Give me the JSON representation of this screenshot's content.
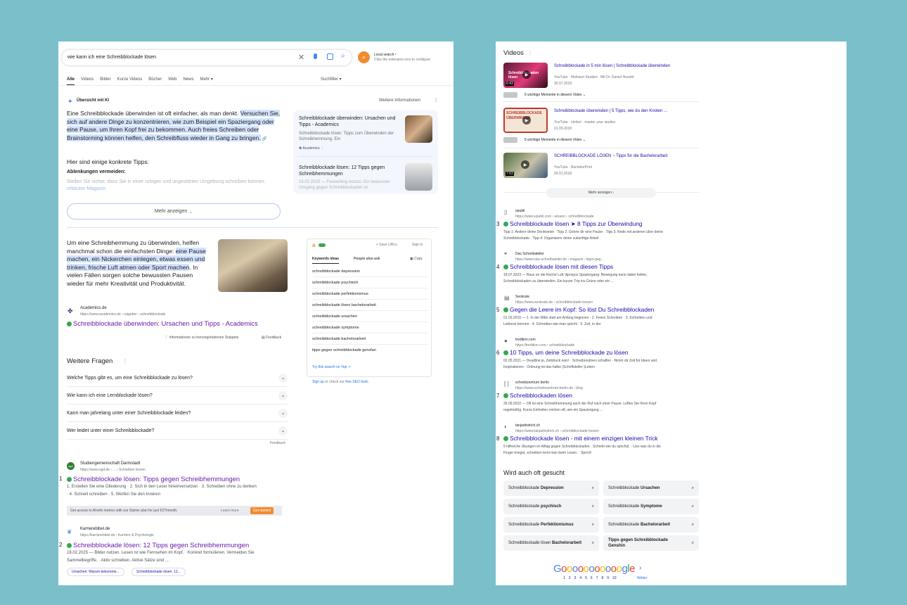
{
  "search": {
    "query": "wie kann ich eine Schreibblockade lösen",
    "ext_title": "Local search ¹",
    "ext_sub": "Click the extension icon to configure",
    "tabs": [
      "Alle",
      "Videos",
      "Bilder",
      "Kurze Videos",
      "Bücher",
      "Web",
      "News",
      "Mehr ▾"
    ],
    "tools": "Suchfilter ▾"
  },
  "ai": {
    "title": "Übersicht mit KI",
    "more_info": "Weitere Informationen",
    "p1_plain": "Eine Schreibblockade überwinden ist oft einfacher, als man denkt. ",
    "p1_hl": "Versuchen Sie, sich auf andere Dinge zu konzentrieren, wie zum Beispiel ein Spaziergang oder eine Pause, um Ihren Kopf frei zu bekommen.  Auch freies Schreiben oder Brainstorming können helfen, den Schreibfluss wieder in Gang zu bringen.",
    "tips_heading": "Hier sind einige konkrete Tipps:",
    "sub_heading": "Ablenkungen vermeiden:",
    "fade_text": "Stellen Sie sicher, dass Sie in einer ruhigen und ungestörten Umgebung schreiben können.",
    "fade_source": "refatutor-Magazin",
    "show_more": "Mehr anzeigen",
    "src1_title": "Schreibblockade überwinden: Ursachen und Tipps - Academics",
    "src1_snip": "Schreibblockade lösen: Tipps zum Überwinden der Schreibhemmung. Ein",
    "src1_site": "Academics",
    "src2_title": "Schreibblockade lösen: 12 Tipps gegen Schreibhemmungen",
    "src2_snip": "18.02.2025 — Freewriting nutzen. Ein bewusster Umgang gegen Schreibblockaden ist"
  },
  "snippet": {
    "t_plain1": "Um eine Schreibhemmung zu überwinden, helfen manchmal schon die einfachsten Dinge: ",
    "t_hl": "eine Pause machen, ein Nickerchen einlegen, etwas essen und trinken, frische Luft atmen oder Sport machen",
    "t_plain2": ". In vielen Fällen sorgen solche bewussten Pausen wieder für mehr Kreativität und Produktivität.",
    "site": "Academics.de",
    "url": "https://www.academics.de › ratgeber › schreibblockade",
    "title": "Schreibblockade überwinden: Ursachen und Tipps - Academics",
    "info": "Informationen zu hervorgehobenen Snippets",
    "feedback": "Feedback"
  },
  "kwbox": {
    "save": "+ Save URLs",
    "signin": "Sign in",
    "tab1": "Keywords ideas",
    "tab2": "People also ask",
    "copy": "Copy",
    "items": [
      "schreibblockade depression",
      "schreibblockade psychisch",
      "schreibblockade perfektionismus",
      "schreibblockade lösen bachelorarbeit",
      "schreibblockade ursachen",
      "schreibblockade symptome",
      "schreibblockade bachelorarbeit",
      "tipps gegen schreibblockade gensfan"
    ],
    "try": "Try this search on Yep ↗",
    "signup": "Sign up",
    "signup_rest": " or check our ",
    "seo": "free SEO tools"
  },
  "paa": {
    "title": "Weitere Fragen",
    "questions": [
      "Welche Tipps gibt es, um eine Schreibblockade zu lösen?",
      "Wie kann ich eine Lernblockade lösen?",
      "Kann man jahrelang unter einer Schreibblockade leiden?",
      "Wer leidet unter einer Schreibblockade?"
    ],
    "feedback": "Feedback"
  },
  "left_results": [
    {
      "num": "1",
      "site": "Studiengemeinschaft Darmstadt",
      "url": "https://www.sgd.de › ... › Schreiben lernen",
      "fav": "sgd",
      "title": "Schreibblockade lösen: Tipps gegen Schreibhemmungen",
      "snip1": "1. Erstellen Sie eine Gliederung · 2. Sich in den Leser hineinversetzen · 3. Schreiben ohne zu denken",
      "snip2": "· 4. Schnell schreiben · 5. Werfen Sie den Innéren"
    },
    {
      "num": "2",
      "site": "Karrierebibel.de",
      "url": "https://karrierebibel.de › Karriere & Psychologie",
      "fav": "K",
      "title": "Schreibblockade lösen: 12 Tipps gegen Schreibhemmungen",
      "snip1": "18.02.2025 — Bilder nutzen. Lesen ist wie Fernsehen im Kopf. · Konkret formulieren. Vermeiden Sie",
      "snip2": "Sammelbegriffe. · Aktiv schreiben. Aktive Sätze sind ..."
    }
  ],
  "ahrefs": {
    "text": "Get access to Ahrefs metrics with our Starter plan for just €27/month.",
    "learn": "Learn more",
    "cta": "Get started"
  },
  "sitelinks": [
    "Ursachen: Warum bekomme...",
    "Schreibblockade lösen: 12..."
  ],
  "videos": {
    "title": "Videos",
    "items": [
      {
        "title": "Schreibblockade in 5 min lösen | Schreibblockade überwinden",
        "meta": "YouTube · Motiviert Studiert · Mit Dr. Daniel Hunold",
        "date": "30.07.2018",
        "moments": "6 wichtige Momente in diesem Video",
        "thumb": "Schreibblockaden lösen",
        "dur": "6:43"
      },
      {
        "title": "Schreibblockade überwinden | 5 Tipps, wie du den Knoten ...",
        "meta": "YouTube · shribe! · master your studies",
        "date": "01.09.2018",
        "moments": "5 wichtige Momente in diesem Video",
        "thumb": "SCHREIBBLOCKADE ÜBERWINDEN",
        "dur": ""
      },
      {
        "title": "SCHREIBBLOCKADE LÖSEN ~ Tipps für die Bachelorarbeit",
        "meta": "YouTube · BachelorPrint",
        "date": "09.01.2018",
        "moments": "",
        "thumb": "",
        "dur": "7:03"
      }
    ],
    "more": "Mehr anzeigen ›"
  },
  "right_results": [
    {
      "num": "3",
      "site": "epubli",
      "url": "https://www.epubli.com › wissen › schreibblockade",
      "title": "Schreibblockade lösen ➤ 8 Tipps zur Überwindung",
      "snip1": "Tipp 1: Ändere deine Denkweise · Tipp 2: Gönne dir eine Pause · Tipp 3: Rede mit anderen über deine",
      "snip2": "Schreibblockade · Tipp 4: Organisiere deine zukünftige Arbeit"
    },
    {
      "num": "4",
      "site": "Das Schreibatelier",
      "url": "https://www.das-schreibatelier.de › magazin › tipps-geg...",
      "title": "Schreibblockade lösen mit diesen Tipps",
      "snip1": "18.07.2023 — Raus an die frische Luft: Apropos Spaziergang: Bewegung kann dabei helfen,",
      "snip2": "Schreibblockaden zu überwinden. Ein kurzer Trip ins Grüne oder ein ..."
    },
    {
      "num": "5",
      "site": "Seokrate",
      "url": "https://www.seokrate.de › schreibblockade-loesen",
      "title": "Gegen die Leere im Kopf: So löst Du Schreibblockaden",
      "snip1": "01.03.2016 — 1. In der Mitte statt am Anfang beginnen · 2. Freies Schreiben · 3. Schreiben und",
      "snip2": "Lektorat trennen · 4. Schreiben wie man spricht · 5. Zeit, in der"
    },
    {
      "num": "6",
      "site": "tredition.com",
      "url": "https://tredition.com › schreibblockade",
      "title": "10 Tipps, um deine Schreibblockade zu lösen",
      "snip1": "02.05.2021 — Deadline je, Zeitdruck nein! · Schreibroutinen schaffen · Nimm dir Zeit für Ideen und",
      "snip2": "Inspirationen · Ordnung ist das halbe (Schriftsteller-)Leben"
    },
    {
      "num": "7",
      "site": "schreibzentrum berlin",
      "url": "https://www.schreibzentrum-berlin.de › blog",
      "title": "Schreibblockaden lösen",
      "snip1": "26.09.2022 — Oft ist eine Schreibhemmung auch der Ruf nach einer Pause. Lüften Sie Ihren Kopf",
      "snip2": "regelmäßig. Kurze Einheiten reichen oft, wie ein Spaziergang ..."
    },
    {
      "num": "8",
      "site": "tanjadristrich.ch",
      "url": "https://www.tanjadristrich.ch › schreibblockade-loesen",
      "title": "Schreibblockade lösen - mit einem einzigen kleinen Trick",
      "snip1": "5 hilfreiche Übungen im Alltag gegen Schreibblockaden · Schreib wie du sprichst. · Lies was du in die",
      "snip2": "Finger kriegst, schreiben lernt man beim Lesen. · Sprich!"
    }
  ],
  "related": {
    "title": "Wird auch oft gesucht",
    "items": [
      {
        "pre": "Schreibblockade ",
        "bold": "Depression"
      },
      {
        "pre": "Schreibblockade ",
        "bold": "Ursachen"
      },
      {
        "pre": "Schreibblockade ",
        "bold": "psychisch"
      },
      {
        "pre": "Schreibblockade ",
        "bold": "Symptome"
      },
      {
        "pre": "Schreibblockade ",
        "bold": "Perfektionismus"
      },
      {
        "pre": "Schreibblockade ",
        "bold": "Bachelorarbeit"
      },
      {
        "pre": "Schreibblockade lösen ",
        "bold": "Bachelorarbeit"
      },
      {
        "pre": "",
        "bold": "Tipps gegen Schreibblockade Genshin"
      }
    ]
  },
  "pager": {
    "logo_letters": [
      "G",
      "o",
      "o",
      "o",
      "o",
      "o",
      "o",
      "o",
      "o",
      "o",
      "o",
      "o",
      "g",
      "l",
      "e"
    ],
    "pages": [
      "1",
      "2",
      "3",
      "4",
      "5",
      "6",
      "7",
      "8",
      "9",
      "10"
    ],
    "next": "Weiter"
  }
}
